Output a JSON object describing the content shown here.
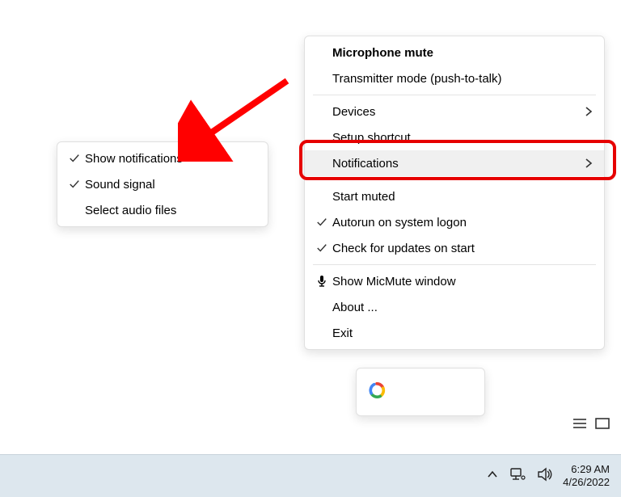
{
  "main_menu": {
    "items": [
      {
        "label": "Microphone mute",
        "bold": true
      },
      {
        "label": "Transmitter mode (push-to-talk)"
      }
    ],
    "group2": [
      {
        "label": "Devices",
        "submenu": true
      },
      {
        "label": "Setup shortcut"
      },
      {
        "label": "Notifications",
        "submenu": true,
        "highlighted": true
      }
    ],
    "group3": [
      {
        "label": "Start muted"
      },
      {
        "label": "Autorun on system logon",
        "checked": true
      },
      {
        "label": "Check for updates on start",
        "checked": true
      }
    ],
    "group4": [
      {
        "label": "Show MicMute window",
        "icon": "mic"
      },
      {
        "label": "About ..."
      },
      {
        "label": "Exit"
      }
    ]
  },
  "sub_menu": {
    "items": [
      {
        "label": "Show notifications",
        "checked": true
      },
      {
        "label": "Sound signal",
        "checked": true
      },
      {
        "label": "Select audio files"
      }
    ]
  },
  "clock": {
    "time": "6:29 AM",
    "date": "4/26/2022"
  },
  "highlight_color": "#e60000",
  "arrow_color": "#ff0000"
}
